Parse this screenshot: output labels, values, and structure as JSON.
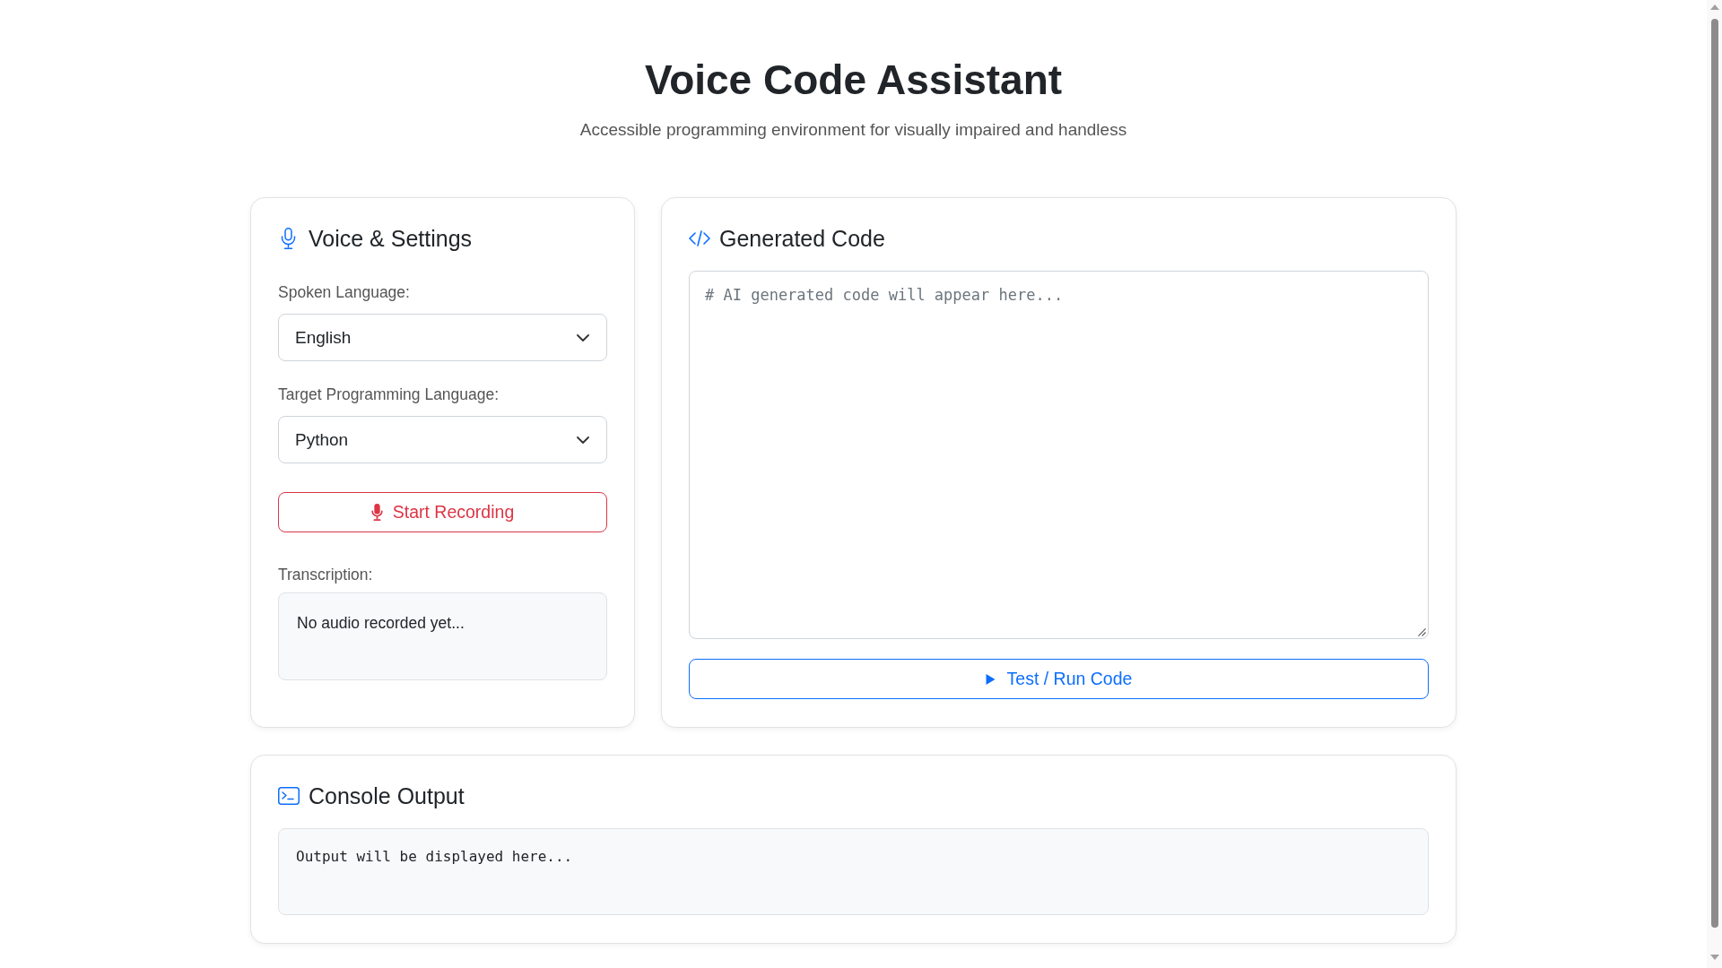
{
  "header": {
    "title": "Voice Code Assistant",
    "subtitle": "Accessible programming environment for visually impaired and handless"
  },
  "settings_panel": {
    "title": "Voice & Settings",
    "fields": [
      {
        "label": "Spoken Language:",
        "value": "English"
      },
      {
        "label": "Target Programming Language:",
        "value": "Python"
      }
    ],
    "record_button": "Start Recording",
    "transcription": {
      "label": "Transcription:",
      "text": "No audio recorded yet..."
    }
  },
  "code_panel": {
    "title": "Generated Code",
    "editor": {
      "placeholder": "# AI generated code will appear here..."
    },
    "run_button": "Test / Run Code"
  },
  "console_panel": {
    "title": "Console Output",
    "output": "Output will be displayed here..."
  }
}
